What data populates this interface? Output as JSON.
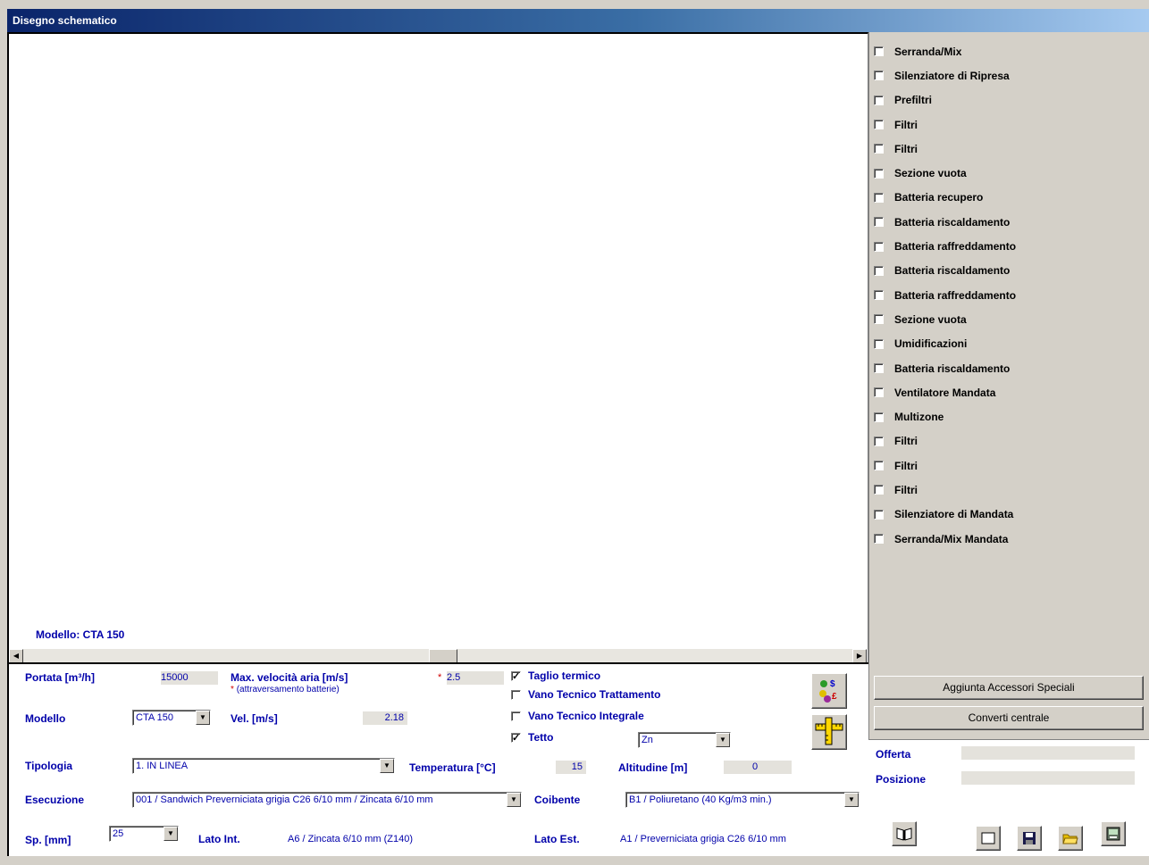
{
  "window": {
    "title": "Disegno schematico"
  },
  "canvas": {
    "model_label": "Modello: CTA 150"
  },
  "components": [
    {
      "label": "Serranda/Mix",
      "checked": false
    },
    {
      "label": "Silenziatore di Ripresa",
      "checked": false
    },
    {
      "label": "Prefiltri",
      "checked": false
    },
    {
      "label": "Filtri",
      "checked": false
    },
    {
      "label": "Filtri",
      "checked": false
    },
    {
      "label": "Sezione vuota",
      "checked": false
    },
    {
      "label": "Batteria recupero",
      "checked": false
    },
    {
      "label": "Batteria riscaldamento",
      "checked": false
    },
    {
      "label": "Batteria raffreddamento",
      "checked": false
    },
    {
      "label": "Batteria riscaldamento",
      "checked": false
    },
    {
      "label": "Batteria raffreddamento",
      "checked": false
    },
    {
      "label": "Sezione vuota",
      "checked": false
    },
    {
      "label": "Umidificazioni",
      "checked": false
    },
    {
      "label": "Batteria riscaldamento",
      "checked": false
    },
    {
      "label": "Ventilatore Mandata",
      "checked": false
    },
    {
      "label": "Multizone",
      "checked": false
    },
    {
      "label": "Filtri",
      "checked": false
    },
    {
      "label": "Filtri",
      "checked": false
    },
    {
      "label": "Filtri",
      "checked": false
    },
    {
      "label": "Silenziatore di Mandata",
      "checked": false
    },
    {
      "label": "Serranda/Mix Mandata",
      "checked": false
    }
  ],
  "buttons": {
    "accessori": "Aggiunta Accessori Speciali",
    "converti": "Converti centrale"
  },
  "info": {
    "offerta_label": "Offerta",
    "posizione_label": "Posizione",
    "offerta_value": "",
    "posizione_value": ""
  },
  "form": {
    "portata_label": "Portata [m³/h]",
    "portata_value": "15000",
    "maxvel_label": "Max. velocità aria [m/s]",
    "maxvel_note_star": "*",
    "maxvel_note": "(attraversamento batterie)",
    "maxvel_star": "*",
    "maxvel_value": "2.5",
    "modello_label": "Modello",
    "modello_value": "CTA 150",
    "vel_label": "Vel. [m/s]",
    "vel_value": "2.18",
    "tipologia_label": "Tipologia",
    "tipologia_value": "1. IN LINEA",
    "temperatura_label": "Temperatura [°C]",
    "temperatura_value": "15",
    "altitudine_label": "Altitudine [m]",
    "altitudine_value": "0",
    "esecuzione_label": "Esecuzione",
    "esecuzione_value": "001 / Sandwich Preverniciata grigia C26 6/10 mm / Zincata 6/10 mm",
    "coibente_label": "Coibente",
    "coibente_value": "B1 / Poliuretano (40 Kg/m3 min.)",
    "sp_label": "Sp. [mm]",
    "sp_value": "25",
    "latoint_label": "Lato Int.",
    "latoint_value": "A6 / Zincata 6/10 mm (Z140)",
    "latoest_label": "Lato Est.",
    "latoest_value": "A1 / Preverniciata grigia C26 6/10 mm",
    "options": [
      {
        "label": "Taglio termico",
        "checked": true
      },
      {
        "label": "Vano Tecnico Trattamento",
        "checked": false
      },
      {
        "label": "Vano Tecnico Integrale",
        "checked": false
      },
      {
        "label": "Tetto",
        "checked": true
      }
    ],
    "tetto_value": "Zn",
    "check_mark": "✓"
  },
  "colors": {
    "label": "#0000aa",
    "title_start": "#0a246a",
    "title_end": "#a6caf0"
  },
  "icons": [
    "scroll-left-icon",
    "scroll-right-icon",
    "price-icon",
    "ruler-icon",
    "book-icon",
    "new-doc-icon",
    "save-icon",
    "open-folder-icon",
    "print-icon"
  ]
}
